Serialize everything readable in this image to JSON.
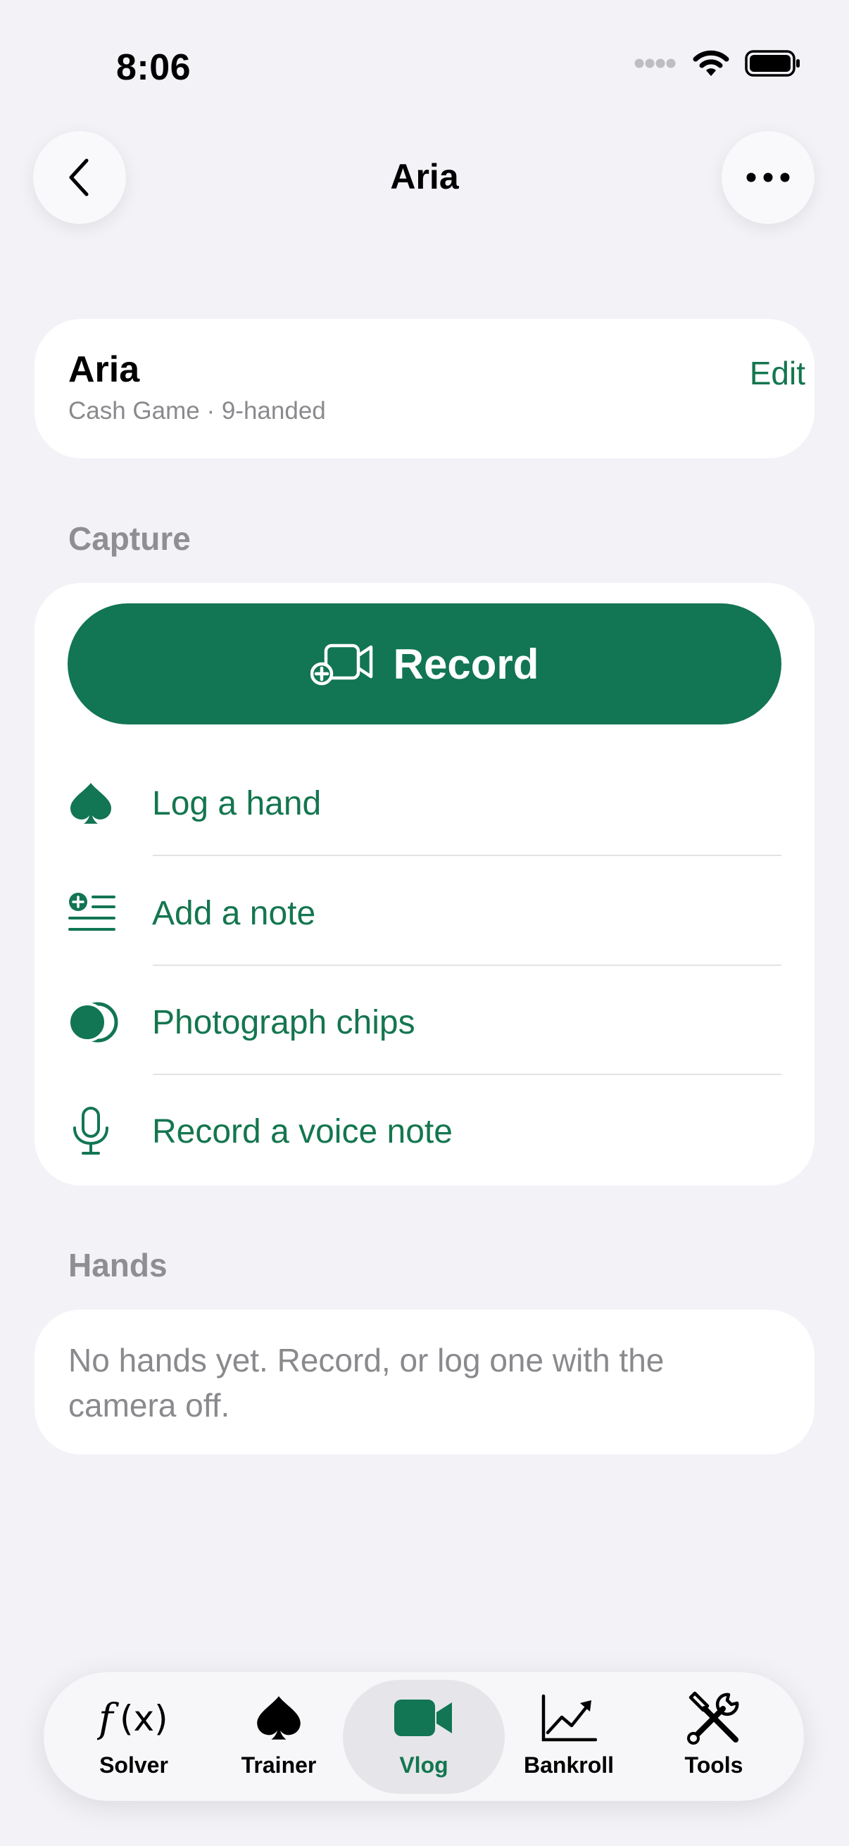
{
  "status_bar": {
    "time": "8:06"
  },
  "nav": {
    "title": "Aria"
  },
  "session": {
    "name": "Aria",
    "subtitle": "Cash Game · 9-handed",
    "edit_label": "Edit"
  },
  "capture": {
    "section_label": "Capture",
    "record_label": "Record",
    "actions": [
      {
        "label": "Log a hand",
        "icon": "spade-icon"
      },
      {
        "label": "Add a note",
        "icon": "add-note-icon"
      },
      {
        "label": "Photograph chips",
        "icon": "chips-icon"
      },
      {
        "label": "Record a voice note",
        "icon": "microphone-icon"
      }
    ]
  },
  "hands": {
    "section_label": "Hands",
    "empty_text": "No hands yet. Record, or log one with the camera off."
  },
  "tabbar": {
    "active": "Vlog",
    "tabs": [
      {
        "label": "Solver",
        "icon": "function-icon"
      },
      {
        "label": "Trainer",
        "icon": "spade-icon"
      },
      {
        "label": "Vlog",
        "icon": "video-camera-icon"
      },
      {
        "label": "Bankroll",
        "icon": "chart-icon"
      },
      {
        "label": "Tools",
        "icon": "tools-icon"
      }
    ]
  },
  "colors": {
    "accent": "#127553",
    "accent_text": "#14764F",
    "background": "#F2F2F7",
    "secondary_text": "#8A8A8E"
  }
}
